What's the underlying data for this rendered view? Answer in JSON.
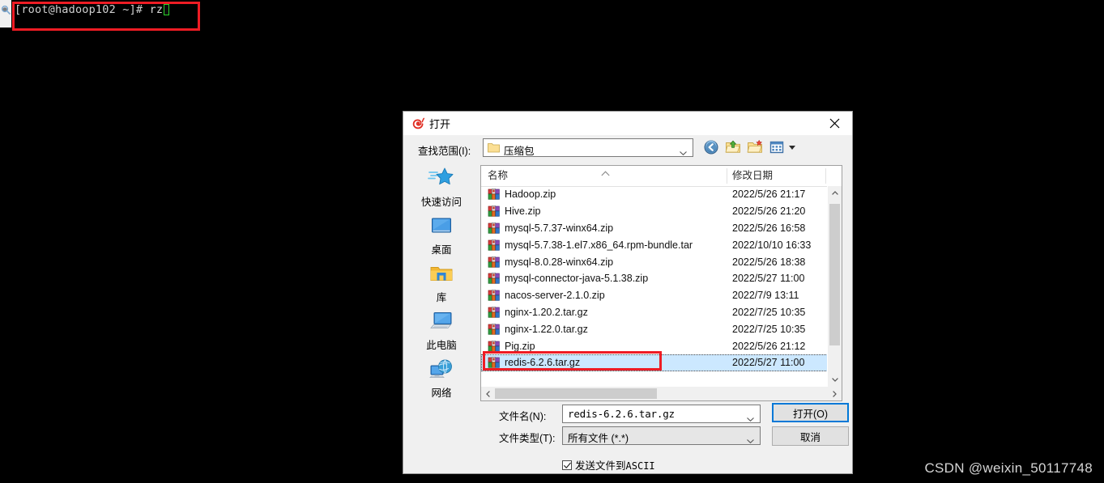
{
  "terminal": {
    "prompt": "[root@hadoop102 ~]# ",
    "command": "rz",
    "cursor": "block-cursor"
  },
  "watermark": {
    "text": "CSDN @weixin_50117748"
  },
  "dialog": {
    "title": "打开",
    "title_icon": "xshell-snail-icon",
    "close_label": "关闭",
    "lookin": {
      "label": "查找范围(I):",
      "value": "压缩包",
      "folder_icon": "folder-icon",
      "dropdown_icon": "chevron-down-icon"
    },
    "toolbar": [
      {
        "name": "back-icon",
        "tooltip": "后退"
      },
      {
        "name": "up-one-level-icon",
        "tooltip": "向上一级"
      },
      {
        "name": "new-folder-icon",
        "tooltip": "新建文件夹"
      },
      {
        "name": "views-icon",
        "tooltip": "视图"
      }
    ],
    "places": [
      {
        "label": "快速访问",
        "icon": "quick-access-star-icon"
      },
      {
        "label": "桌面",
        "icon": "desktop-monitor-icon"
      },
      {
        "label": "库",
        "icon": "library-folder-icon"
      },
      {
        "label": "此电脑",
        "icon": "this-pc-icon"
      },
      {
        "label": "网络",
        "icon": "network-globe-icon"
      }
    ],
    "list": {
      "columns": [
        "名称",
        "修改日期"
      ],
      "sort_indicator": "sort-ascending-chevron-icon",
      "file_icon": "winrar-archive-icon",
      "rows": [
        {
          "name": "Hadoop.zip",
          "date": "2022/5/26 21:17",
          "selected": false
        },
        {
          "name": "Hive.zip",
          "date": "2022/5/26 21:20",
          "selected": false
        },
        {
          "name": "mysql-5.7.37-winx64.zip",
          "date": "2022/5/26 16:58",
          "selected": false
        },
        {
          "name": "mysql-5.7.38-1.el7.x86_64.rpm-bundle.tar",
          "date": "2022/10/10 16:33",
          "selected": false
        },
        {
          "name": "mysql-8.0.28-winx64.zip",
          "date": "2022/5/26 18:38",
          "selected": false
        },
        {
          "name": "mysql-connector-java-5.1.38.zip",
          "date": "2022/5/27 11:00",
          "selected": false
        },
        {
          "name": "nacos-server-2.1.0.zip",
          "date": "2022/7/9 13:11",
          "selected": false
        },
        {
          "name": "nginx-1.20.2.tar.gz",
          "date": "2022/7/25 10:35",
          "selected": false
        },
        {
          "name": "nginx-1.22.0.tar.gz",
          "date": "2022/7/25 10:35",
          "selected": false
        },
        {
          "name": "Pig.zip",
          "date": "2022/5/26 21:12",
          "selected": false
        },
        {
          "name": "redis-6.2.6.tar.gz",
          "date": "2022/5/27 11:00",
          "selected": true
        }
      ]
    },
    "filename": {
      "label": "文件名(N):",
      "value": "redis-6.2.6.tar.gz"
    },
    "filetype": {
      "label": "文件类型(T):",
      "value": "所有文件 (*.*)"
    },
    "buttons": {
      "open": "打开(O)",
      "cancel": "取消"
    },
    "ascii": {
      "label_text": "发送文件到",
      "label_mono": "ASCII",
      "checked": true
    }
  },
  "annotations": {
    "accent_color": "#ee1c24",
    "terminal_box": "red-highlight-box-terminal",
    "row_box": "red-highlight-box-selected-file"
  }
}
